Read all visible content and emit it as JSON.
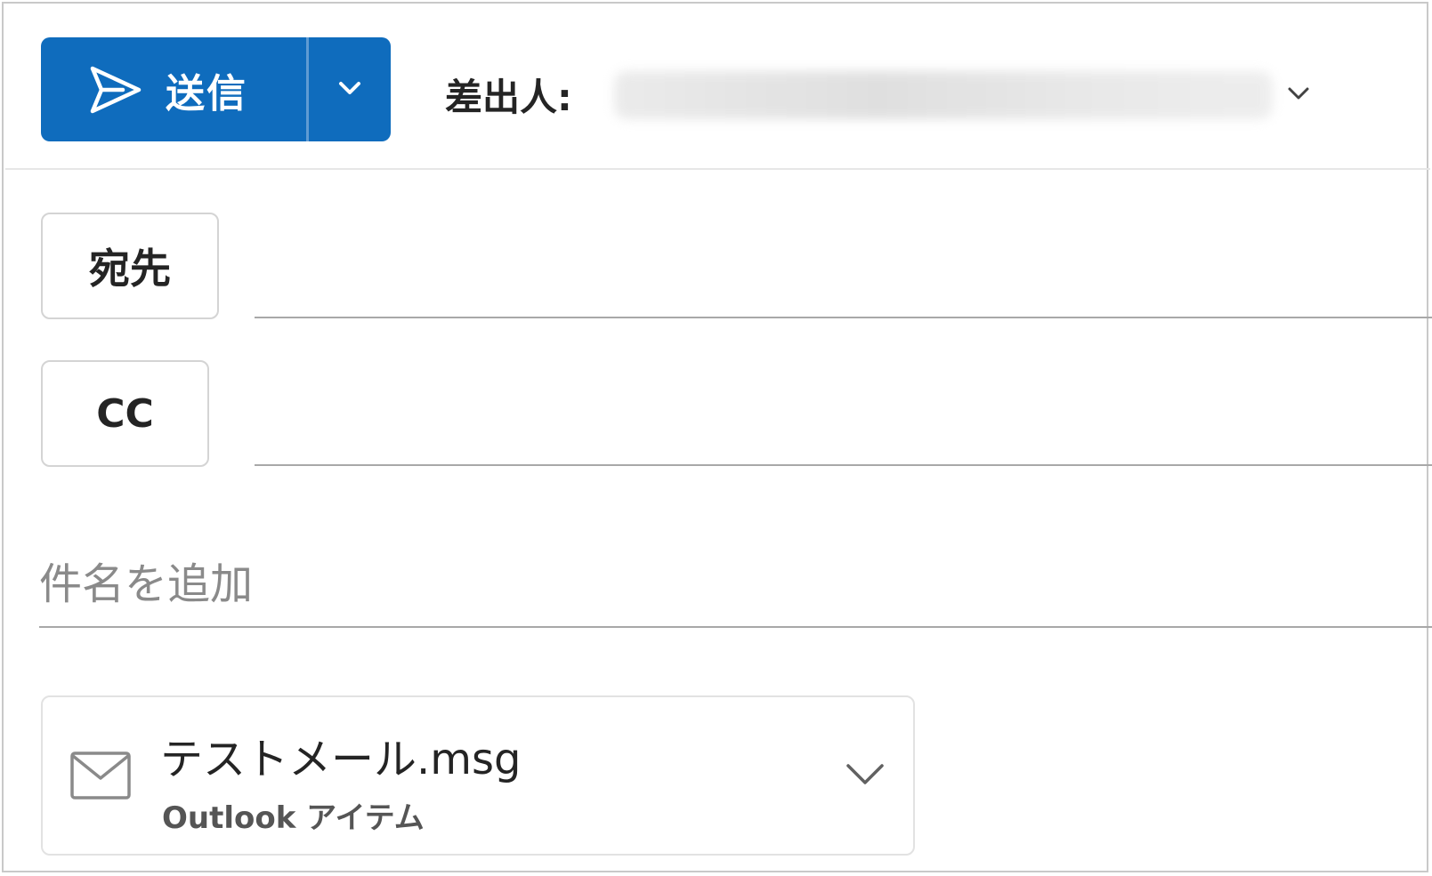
{
  "toolbar": {
    "send_label": "送信",
    "from_label": "差出人:",
    "from_value": "",
    "accent_color": "#0f6cbd"
  },
  "recipients": {
    "to_label": "宛先",
    "to_value": "",
    "cc_label": "CC",
    "cc_value": ""
  },
  "subject": {
    "placeholder": "件名を追加",
    "value": ""
  },
  "attachment": {
    "file_name": "テストメール.msg",
    "file_type": "Outlook アイテム",
    "icon": "mail-icon"
  },
  "icons": {
    "send": "send-icon",
    "send_options": "chevron-down-icon",
    "from_dropdown": "chevron-down-icon",
    "attachment_menu": "chevron-down-icon"
  }
}
